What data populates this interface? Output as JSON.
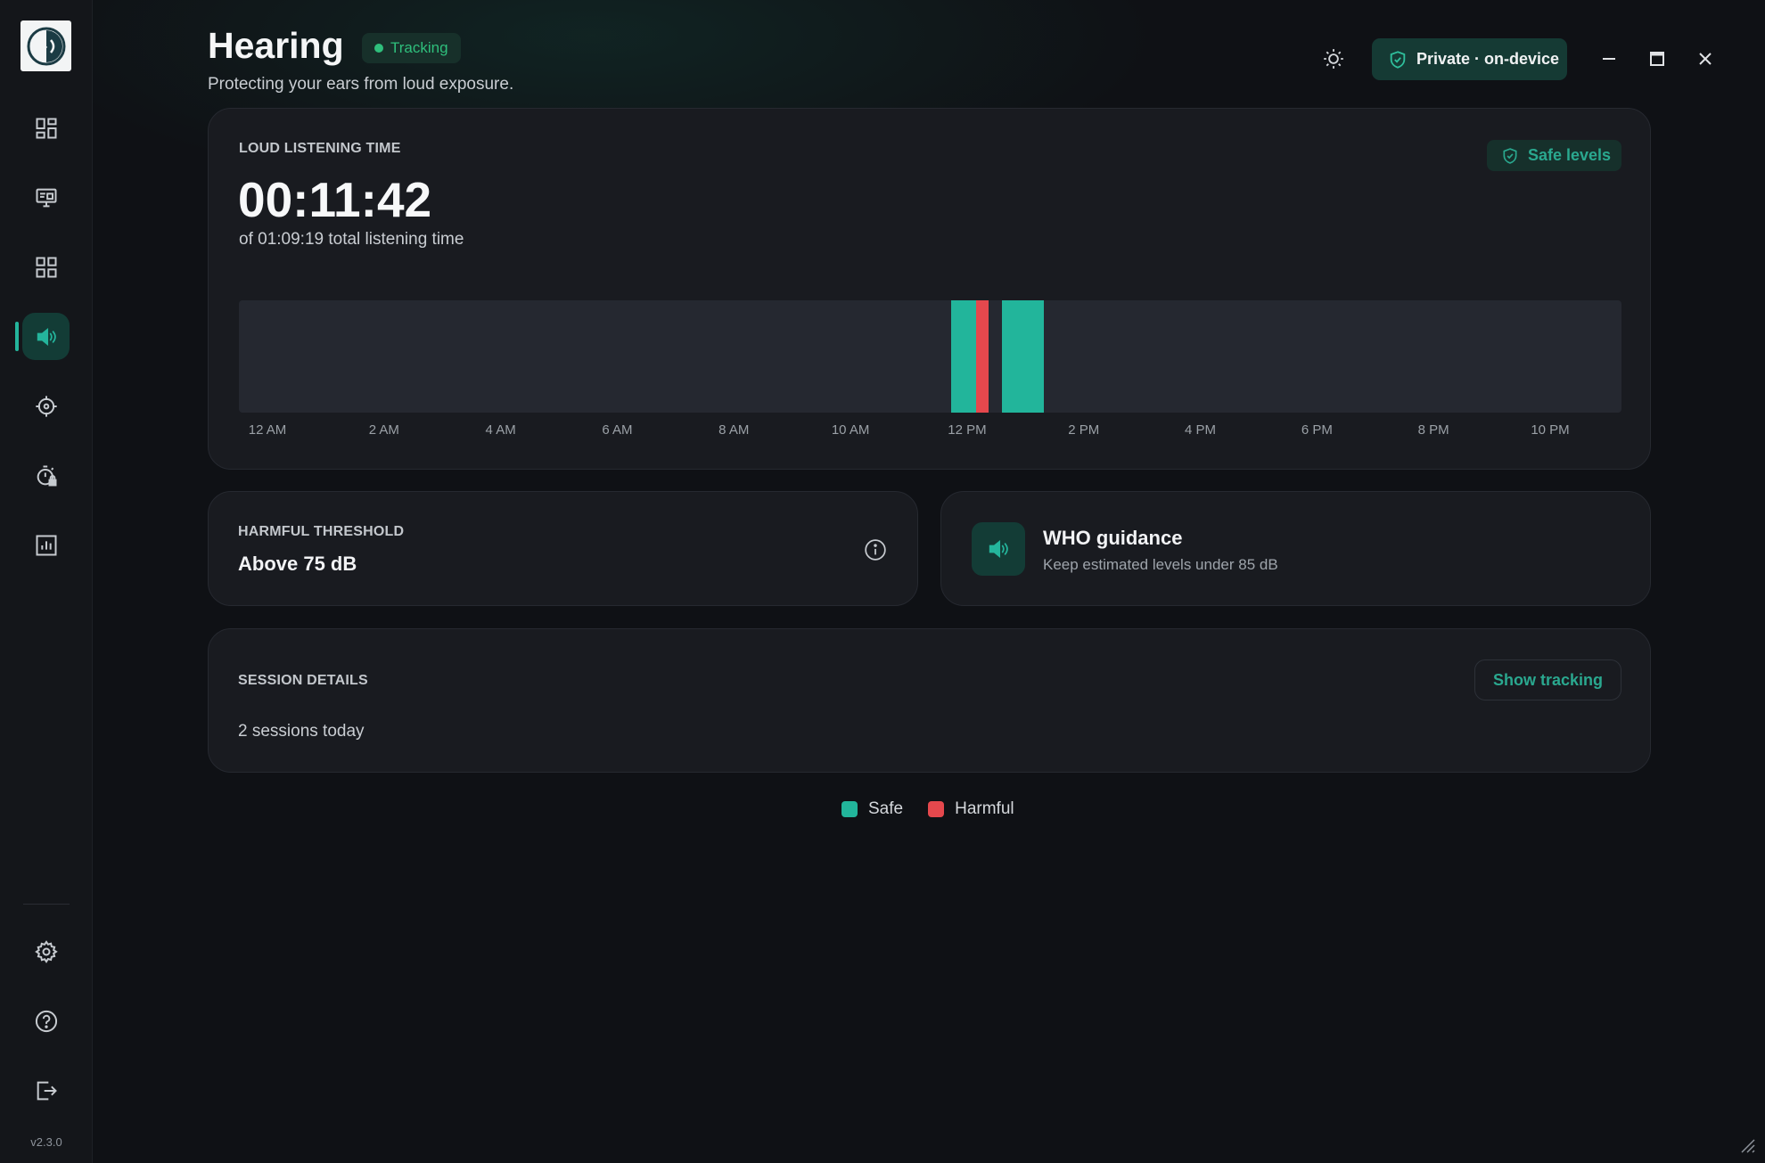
{
  "app": {
    "version": "v2.3.0"
  },
  "colors": {
    "accent": "#24b59c",
    "safe": "#22b59b",
    "harmful": "#e5484d",
    "tracking": "#2fbf7c"
  },
  "sidebar": {
    "items": [
      {
        "name": "dashboard",
        "icon": "dashboard-icon",
        "active": false
      },
      {
        "name": "screen-time",
        "icon": "monitor-icon",
        "active": false
      },
      {
        "name": "apps",
        "icon": "apps-grid-icon",
        "active": false
      },
      {
        "name": "hearing",
        "icon": "speaker-icon",
        "active": true
      },
      {
        "name": "focus",
        "icon": "crosshair-icon",
        "active": false
      },
      {
        "name": "limits",
        "icon": "timer-lock-icon",
        "active": false
      },
      {
        "name": "reports",
        "icon": "bar-chart-icon",
        "active": false
      }
    ],
    "bottom": [
      {
        "name": "settings",
        "icon": "gear-icon"
      },
      {
        "name": "help",
        "icon": "help-icon"
      },
      {
        "name": "logout",
        "icon": "logout-icon"
      }
    ]
  },
  "header": {
    "title": "Hearing",
    "status": "Tracking",
    "subtitle": "Protecting your ears from loud exposure.",
    "privacy_badge": "Private · on-device"
  },
  "loud_listening": {
    "label": "LOUD LISTENING TIME",
    "value": "00:11:42",
    "total": "of 01:09:19 total listening time",
    "status_badge": "Safe levels"
  },
  "chart_data": {
    "type": "timeline",
    "x_range_hours": [
      0,
      24
    ],
    "tick_labels": [
      "12 AM",
      "2 AM",
      "4 AM",
      "6 AM",
      "8 AM",
      "10 AM",
      "12 PM",
      "2 PM",
      "4 PM",
      "6 PM",
      "8 PM",
      "10 PM"
    ],
    "segments": [
      {
        "start": 12.37,
        "end": 12.8,
        "level": "safe"
      },
      {
        "start": 12.8,
        "end": 13.02,
        "level": "harmful"
      },
      {
        "start": 13.25,
        "end": 13.98,
        "level": "safe"
      }
    ]
  },
  "threshold": {
    "label": "HARMFUL THRESHOLD",
    "value": "Above 75 dB"
  },
  "who": {
    "title": "WHO guidance",
    "subtitle": "Keep estimated levels under 85 dB"
  },
  "session": {
    "label": "SESSION DETAILS",
    "count": "2 sessions today",
    "button": "Show tracking"
  },
  "legend": [
    {
      "label": "Safe",
      "color": "#22b59b"
    },
    {
      "label": "Harmful",
      "color": "#e5484d"
    }
  ]
}
